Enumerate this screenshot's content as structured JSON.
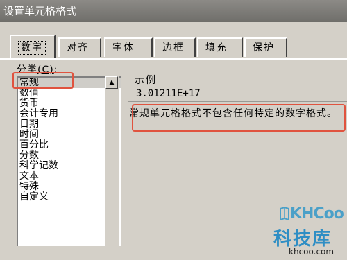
{
  "window": {
    "title": "设置单元格格式"
  },
  "tabs": [
    {
      "label": "数字",
      "active": true
    },
    {
      "label": "对齐",
      "active": false
    },
    {
      "label": "字体",
      "active": false
    },
    {
      "label": "边框",
      "active": false
    },
    {
      "label": "填充",
      "active": false
    },
    {
      "label": "保护",
      "active": false
    }
  ],
  "category": {
    "label_prefix": "分类",
    "label_key": "(C)",
    "label_suffix": ":",
    "selected": "常规",
    "items": [
      "常规",
      "数值",
      "货币",
      "会计专用",
      "日期",
      "时间",
      "百分比",
      "分数",
      "科学记数",
      "文本",
      "特殊",
      "自定义"
    ]
  },
  "sample": {
    "label": "示例",
    "value": "3.01211E+17"
  },
  "description": "常规单元格格式不包含任何特定的数字格式。",
  "watermark": {
    "logo": "KHCoo",
    "chinese": "科技库",
    "url": "khcoo.com"
  },
  "colors": {
    "highlight": "#e0533f",
    "dialog_bg": "#d4d0c8",
    "watermark_blue": "#4ba0c8"
  }
}
